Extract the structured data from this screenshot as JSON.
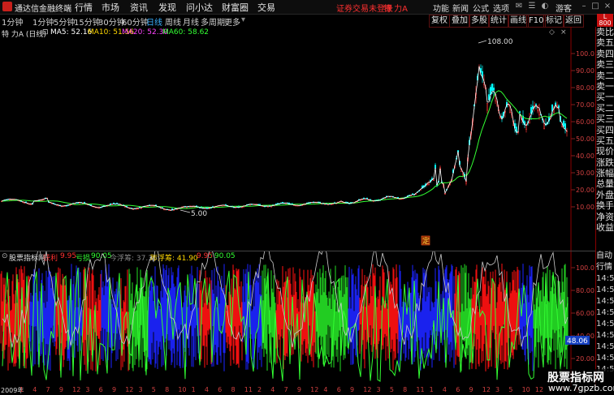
{
  "app": {
    "title": "通达信金融终端"
  },
  "menu": {
    "items": [
      "行情",
      "市场",
      "资讯",
      "发现",
      "问小达",
      "财富圈",
      "交易"
    ]
  },
  "status": {
    "login_warning": "证券交易未登录",
    "stock_label": "特 力A"
  },
  "right_menu": {
    "items": [
      "功能",
      "新闻",
      "公式",
      "选项"
    ],
    "user": "游客"
  },
  "period_bar": {
    "periods": [
      "1分钟",
      "1分钟",
      "5分钟",
      "15分钟",
      "30分钟",
      "60分钟",
      "日线",
      "周线",
      "月线",
      "多周期",
      "更多"
    ],
    "active_index": 6,
    "tools": [
      "复权",
      "叠加",
      "多股",
      "统计",
      "画线",
      "F10",
      "标记",
      "返回"
    ]
  },
  "main_chart": {
    "stock": "特 力A (日线)",
    "ma_labels": [
      {
        "text": "MA5: 52.16",
        "color": "#ffffff"
      },
      {
        "text": "MA10: 51.56",
        "color": "#ffd700"
      },
      {
        "text": "MA20: 52.30",
        "color": "#ff44ff"
      },
      {
        "text": "MA60: 58.62",
        "color": "#33ff33"
      }
    ],
    "high_marker": "108.00",
    "low_marker": "5.00",
    "event_marker": "定",
    "y_ticks": [
      "100.0",
      "90.00",
      "80.00",
      "70.00",
      "60.00",
      "50.00",
      "40.00",
      "30.00",
      "20.00",
      "10.00"
    ],
    "up_color": "#ff3232",
    "down_color": "#00ffff"
  },
  "side_panel": {
    "items": [
      "卖比",
      "卖五",
      "卖四",
      "卖三",
      "卖二",
      "卖一",
      "买一",
      "买二",
      "买三",
      "买四",
      "买五",
      "现价",
      "涨跌",
      "涨幅",
      "总量",
      "外盘",
      "换手",
      "净资",
      "收益"
    ]
  },
  "ticket_tab": "L 800",
  "indicator": {
    "name": "股票指标网",
    "labels": [
      {
        "text": "获利",
        "color": "#ff3030"
      },
      {
        "text": "9.95",
        "color": "#ff3030"
      },
      {
        "text": "亏损",
        "color": "#33ff33"
      },
      {
        "text": "90.05",
        "color": "#33ff33"
      },
      {
        "text": "今浮筹: 37.36",
        "color": "#888888"
      },
      {
        "text": "昨浮筹: 41.90",
        "color": "#ffd700"
      },
      {
        "text": "9.95",
        "color": "#ff3030"
      },
      {
        "text": ": 90.05",
        "color": "#33ff33"
      }
    ],
    "y_ticks": [
      "100.0",
      "80.00",
      "60.00",
      "40.00",
      "20.00"
    ],
    "current_value": "48.06"
  },
  "indicator_side": {
    "items": [
      "自动",
      "行情",
      "14:50",
      "14:50",
      "14:50",
      "14:50",
      "14:50",
      "14:50",
      "14:50",
      "14:50",
      "14:50"
    ]
  },
  "date_axis": {
    "labels": [
      "2009年",
      "1",
      "4",
      "7",
      "9",
      "12",
      "3",
      "6",
      "9",
      "12",
      "3",
      "5",
      "8",
      "10",
      "1",
      "4",
      "6",
      "8",
      "11",
      "2",
      "4",
      "7",
      "9",
      "12",
      "4",
      "6",
      "9",
      "12",
      "3",
      "5",
      "8",
      "11",
      "1",
      "4",
      "6",
      "9",
      "12",
      "3",
      "5",
      "10",
      "12",
      "3",
      "5",
      "9"
    ]
  },
  "watermark": {
    "line1": "股票指标网",
    "line2": "www.7gpzb.com"
  }
}
